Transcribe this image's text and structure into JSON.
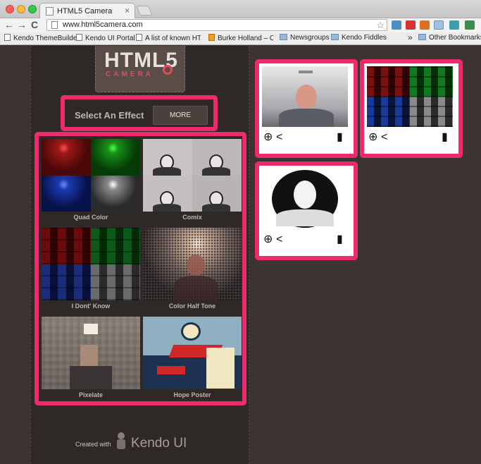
{
  "browser": {
    "tab_title": "HTML5 Camera",
    "tab_close": "×",
    "url": "www.html5camera.com",
    "nav": {
      "back": "←",
      "forward": "→",
      "reload": "C"
    },
    "star": "☆"
  },
  "bookmarks": {
    "items": [
      {
        "label": "Kendo ThemeBuilder",
        "icon": "page-icon"
      },
      {
        "label": "Kendo UI Portal",
        "icon": "page-icon"
      },
      {
        "label": "A list of known HTM",
        "icon": "page-icon"
      },
      {
        "label": "Burke Holland – Out",
        "icon": "blogger-icon"
      },
      {
        "label": "Newsgroups",
        "icon": "folder-icon"
      },
      {
        "label": "Kendo Fiddles",
        "icon": "folder-icon"
      }
    ],
    "overflow": "»",
    "other": "Other Bookmarks"
  },
  "logo": {
    "title": "HTML5",
    "subtitle": "CAMERA"
  },
  "effect_selector": {
    "label": "Select An Effect",
    "more": "MORE"
  },
  "effects": [
    {
      "name": "Quad Color"
    },
    {
      "name": "Comix"
    },
    {
      "name": "I Dont' Know"
    },
    {
      "name": "Color Half Tone"
    },
    {
      "name": "Pixelate"
    },
    {
      "name": "Hope Poster"
    }
  ],
  "photo_tools": {
    "download": "download-icon",
    "share": "share-icon",
    "delete": "trash-icon"
  },
  "footer": {
    "created_with": "Created with",
    "brand": "Kendo UI"
  },
  "colors": {
    "accent": "#ee2b6c",
    "panel": "#2e2826",
    "background": "#3c3431"
  }
}
